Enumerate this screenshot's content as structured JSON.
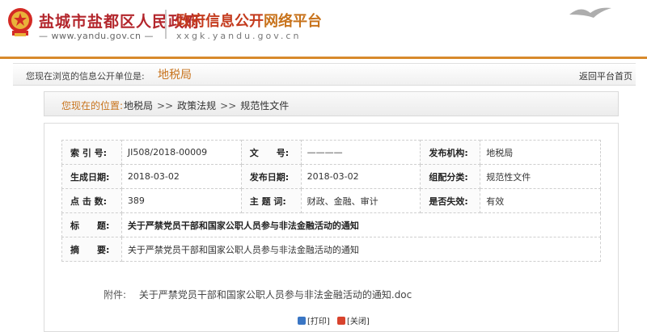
{
  "header": {
    "gov_name": "盐城市盐都区人民政府",
    "gov_domain": "— www.yandu.gov.cn —",
    "platform_title_main": "政府信息公开",
    "platform_title_tail": "网络平台",
    "platform_domain": "xxgk.yandu.gov.cn"
  },
  "location": {
    "label": "您现在浏览的信息公开单位是:",
    "unit": "地税局",
    "back_link": "返回平台首页"
  },
  "breadcrumb": {
    "label": "您现在的位置:",
    "items": [
      "地税局",
      "政策法规",
      "规范性文件"
    ],
    "separator": ">>"
  },
  "meta": {
    "index_label": "索 引 号:",
    "index_value": "JI508/2018-00009",
    "doc_no_label": "文　　号:",
    "doc_no_value": "————",
    "publisher_label": "发布机构:",
    "publisher_value": "地税局",
    "created_label": "生成日期:",
    "created_value": "2018-03-02",
    "published_label": "发布日期:",
    "published_value": "2018-03-02",
    "category_label": "组配分类:",
    "category_value": "规范性文件",
    "clicks_label": "点 击 数:",
    "clicks_value": "389",
    "keywords_label": "主 题 词:",
    "keywords_value": "财政、金融、审计",
    "valid_label": "是否失效:",
    "valid_value": "有效",
    "title_label": "标　　题:",
    "title_value": "关于严禁党员干部和国家公职人员参与非法金融活动的通知",
    "summary_label": "摘　　要:",
    "summary_value": "关于严禁党员干部和国家公职人员参与非法金融活动的通知"
  },
  "attachment": {
    "label": "附件:",
    "file": "关于严禁党员干部和国家公职人员参与非法金融活动的通知.doc"
  },
  "actions": {
    "print": "[打印]",
    "close": "[关闭]"
  },
  "colors": {
    "brand_red": "#b3262c",
    "accent_orange": "#c8731c"
  }
}
